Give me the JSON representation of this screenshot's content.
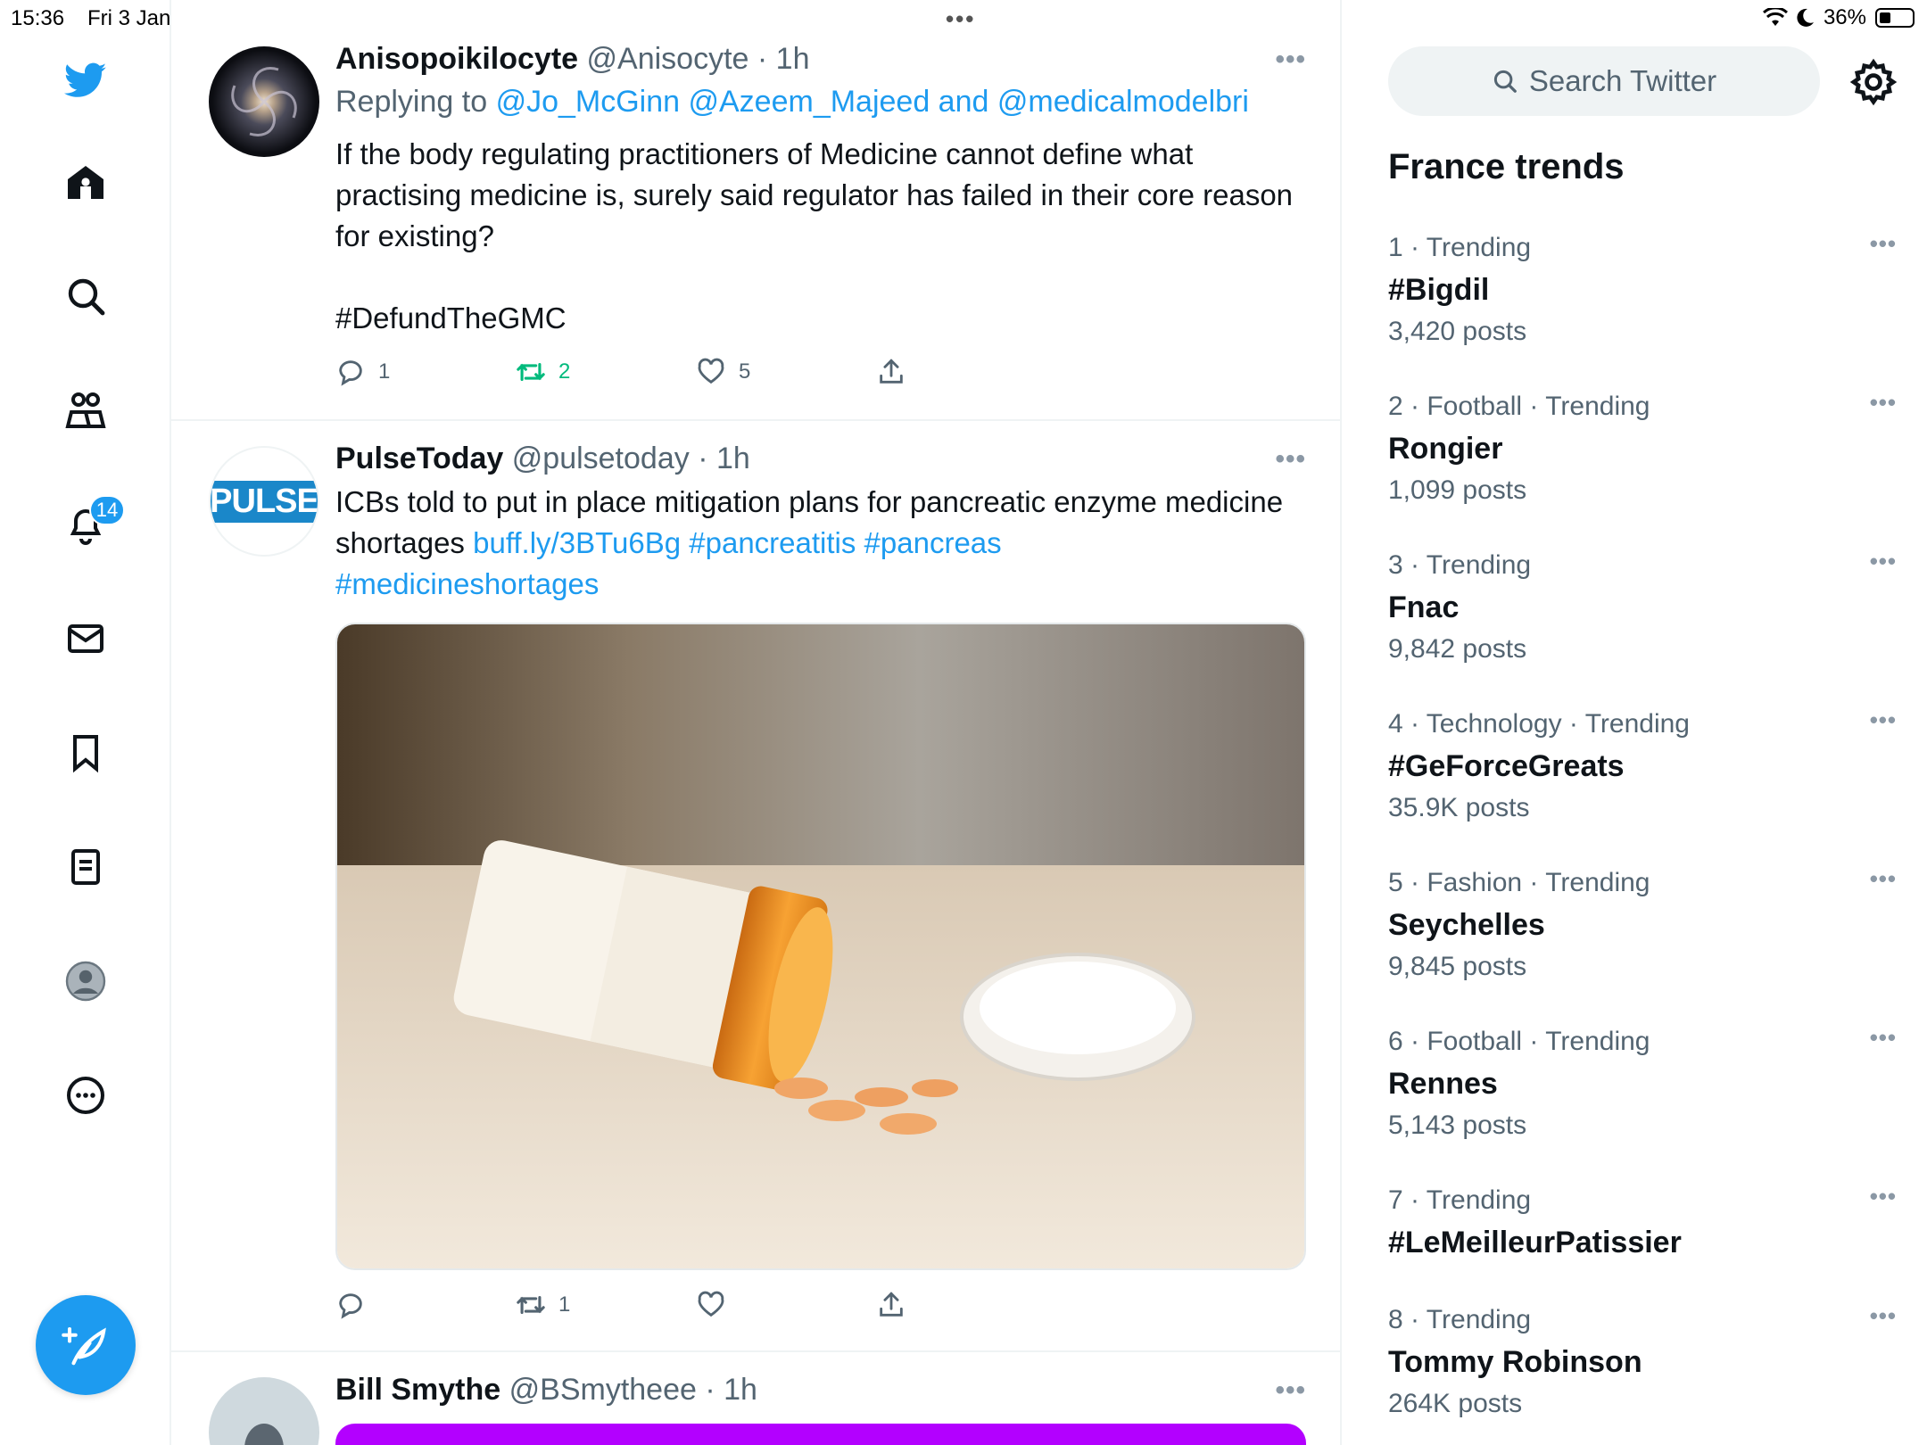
{
  "status_bar": {
    "time": "15:36",
    "date": "Fri 3 Jan",
    "battery": "36%"
  },
  "nav": {
    "notifications_badge": "14"
  },
  "tweets": [
    {
      "name": "Anisopoikilocyte",
      "handle": "@Anisocyte",
      "time": "· 1h",
      "replying_prefix": "Replying to",
      "replying_to": "@Jo_McGinn @Azeem_Majeed and @medicalmodelbri",
      "text": "If the body regulating practitioners of Medicine cannot define what practising medicine is, surely said regulator has failed in their core reason for existing?",
      "hashtag": "#DefundTheGMC",
      "replies": "1",
      "retweets": "2",
      "likes": "5"
    },
    {
      "name": "PulseToday",
      "handle": "@pulsetoday",
      "time": "· 1h",
      "avatar_text": "PULSE",
      "text": "ICBs told to put in place mitigation plans for pancreatic enzyme medicine shortages",
      "link": "buff.ly/3BTu6Bg",
      "tags_line1": "#pancreatitis #pancreas",
      "tags_line2": "#medicineshortages",
      "retweets": "1"
    },
    {
      "name": "Bill Smythe",
      "handle": "@BSmytheee",
      "time": "· 1h"
    }
  ],
  "sidebar": {
    "search_placeholder": "Search Twitter",
    "trends_title": "France trends",
    "trends": [
      {
        "meta": "1 · Trending",
        "name": "#Bigdil",
        "posts": "3,420 posts"
      },
      {
        "meta": "2 · Football · Trending",
        "name": "Rongier",
        "posts": "1,099 posts"
      },
      {
        "meta": "3 · Trending",
        "name": "Fnac",
        "posts": "9,842 posts"
      },
      {
        "meta": "4 · Technology · Trending",
        "name": "#GeForceGreats",
        "posts": "35.9K posts"
      },
      {
        "meta": "5 · Fashion · Trending",
        "name": "Seychelles",
        "posts": "9,845 posts"
      },
      {
        "meta": "6 · Football · Trending",
        "name": "Rennes",
        "posts": "5,143 posts"
      },
      {
        "meta": "7 · Trending",
        "name": "#LeMeilleurPatissier",
        "posts": ""
      },
      {
        "meta": "8 · Trending",
        "name": "Tommy Robinson",
        "posts": "264K posts"
      }
    ]
  },
  "colors": {
    "accent": "#1d9bf0",
    "retweet": "#00ba7c",
    "muted": "#536471"
  }
}
